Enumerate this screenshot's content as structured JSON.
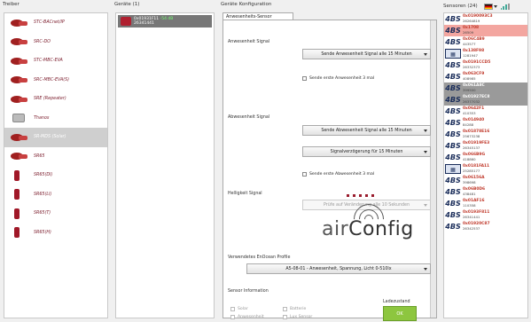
{
  "panes": {
    "treiber_title": "Treiber",
    "geraete_title": "Geräte (1)",
    "konfig_title": "Geräte Konfiguration",
    "sensoren_title": "Sensoren (24)"
  },
  "drivers": [
    {
      "label": "STC-BACnet/IP",
      "icon": "gateway-icon"
    },
    {
      "label": "SRC-DO",
      "icon": "gateway-icon"
    },
    {
      "label": "STC-MBC-EVA",
      "icon": "gateway-icon"
    },
    {
      "label": "SRC-MBC-EVA(S)",
      "icon": "gateway-icon"
    },
    {
      "label": "SRE (Repeater)",
      "icon": "repeater-icon"
    },
    {
      "label": "Thanos",
      "icon": "room-panel-icon"
    },
    {
      "label": "SR-MDS (Solar)",
      "icon": "motion-sensor-icon",
      "selected": true
    },
    {
      "label": "SR65",
      "icon": "gateway-icon"
    },
    {
      "label": "SR65(DI)",
      "icon": "temp-sensor-icon"
    },
    {
      "label": "SR65(LI)",
      "icon": "temp-sensor-icon"
    },
    {
      "label": "SR65(T)",
      "icon": "temp-sensor-icon"
    },
    {
      "label": "SR65(H)",
      "icon": "temp-sensor-icon"
    }
  ],
  "devices": [
    {
      "id": "0x01931F11",
      "rssi": "-54 dB",
      "sub": "26341441"
    }
  ],
  "konfig": {
    "tab_label": "Anwesenheits-Sensor",
    "anwesenheit": {
      "label": "Anwesenheit Signal",
      "dropdown": "Sende Anwesenheit Signal alle 15 Minuten",
      "checkbox": "Sende erste Anwesenheit 3 mal"
    },
    "abwesenheit": {
      "label": "Abwesenheit Signal",
      "dropdown": "Sende Abwesenheit Signal alle 15 Minuten",
      "delay_dropdown": "Signalverzögerung für 15 Minuten",
      "checkbox": "Sende erste Abwesenheit 3 mal"
    },
    "helligkeit": {
      "label": "Helligkeit Signal",
      "dropdown": "Prüfe auf Veränderung alle 10 Sekunden"
    },
    "logo_text_a": "air",
    "logo_text_b": "Config",
    "profil": {
      "label": "Verwendetes EnOcean Profile",
      "dropdown": "A5-08-01 - Anwesenheit, Spannung, Licht 0-510lx"
    },
    "sensor_info": {
      "label": "Sensor Information",
      "checks": [
        "Solar",
        "Batterie",
        "Anwesenheit",
        "Lux Sensor"
      ],
      "ladezustand_label": "Ladezustand",
      "ladezustand_value": "OK"
    }
  },
  "sensors": [
    {
      "id": "0x0190093C3",
      "val": "26264819",
      "icon": "4BS"
    },
    {
      "id": "0x1708",
      "val": "26509",
      "icon": "4BS",
      "state": "highlight"
    },
    {
      "id": "0x06C4B9",
      "val": "443577",
      "icon": "4BS"
    },
    {
      "id": "0x138F98",
      "val": "1281947",
      "icon": "RPS"
    },
    {
      "id": "0x0191CCD5",
      "val": "26332373",
      "icon": "4BS"
    },
    {
      "id": "0x063CF9",
      "val": "408985",
      "icon": "4BS"
    },
    {
      "id": "0x061A8C",
      "val": "399500",
      "icon": "4BS",
      "state": "selected"
    },
    {
      "id": "0x01927EC8",
      "val": "26377032",
      "icon": "4BS",
      "state": "selected"
    },
    {
      "id": "0x0642F1",
      "val": "410353",
      "icon": "4BS"
    },
    {
      "id": "0x014940",
      "val": "84288",
      "icon": "4BS"
    },
    {
      "id": "0x01878E16",
      "val": "25673238",
      "icon": "4BS"
    },
    {
      "id": "0x01919FE3",
      "val": "26345137",
      "icon": "4BS"
    },
    {
      "id": "0x066B9G",
      "val": "418860",
      "icon": "4BS"
    },
    {
      "id": "0x0181FA11",
      "val": "25285177",
      "icon": "RPS"
    },
    {
      "id": "0x06156A",
      "val": "398698",
      "icon": "4BS"
    },
    {
      "id": "0x06B0D6",
      "val": "438481",
      "icon": "4BS"
    },
    {
      "id": "0x01AF16",
      "val": "110358",
      "icon": "4BS"
    },
    {
      "id": "0x0193F811",
      "val": "26341441",
      "icon": "4BS"
    },
    {
      "id": "0x01920C87",
      "val": "26342537",
      "icon": "4BS"
    }
  ]
}
